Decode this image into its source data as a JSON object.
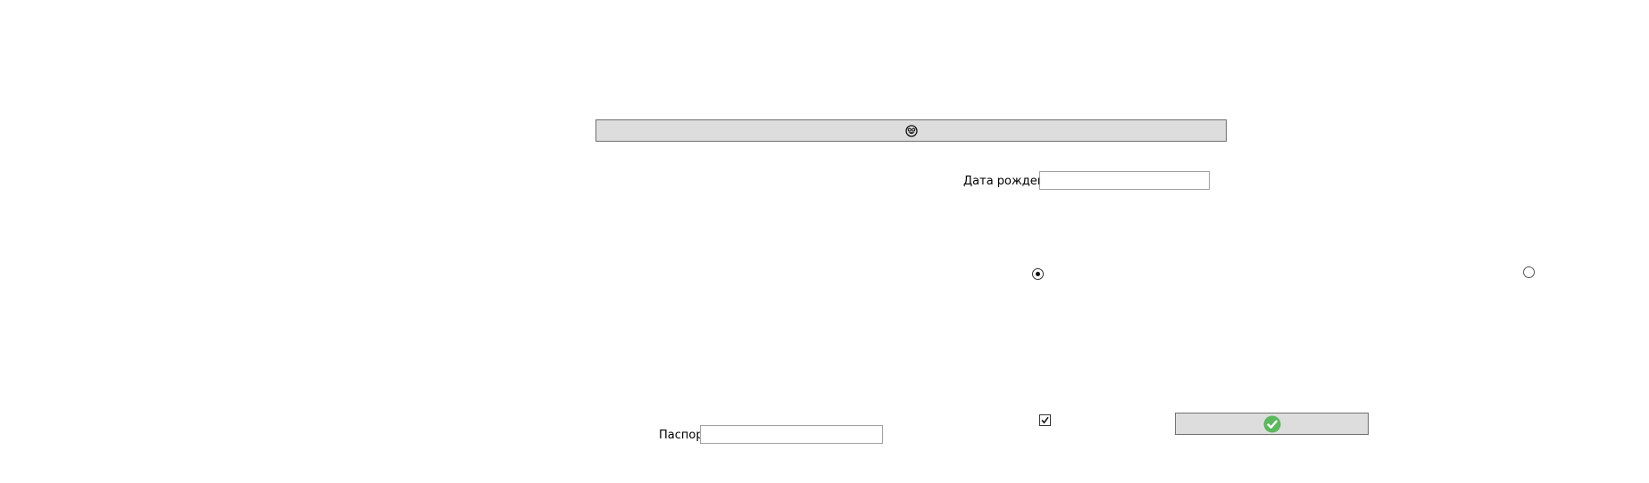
{
  "form": {
    "top_button_icon": "smiley-face-icon",
    "birth_date": {
      "label": "Дата рождения",
      "value": ""
    },
    "passport": {
      "label": "Паспорт",
      "value": ""
    },
    "radio_options": [
      {
        "checked": true
      },
      {
        "checked": false
      }
    ],
    "checkbox": {
      "checked": true
    },
    "confirm_button_icon": "green-checkmark-icon"
  },
  "colors": {
    "button_background": "#dddddd",
    "button_border": "#707070",
    "confirm_icon": "#5cb85c",
    "input_border": "#a0a0a0"
  }
}
